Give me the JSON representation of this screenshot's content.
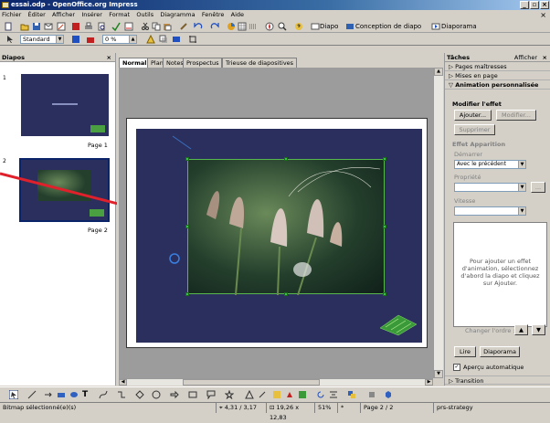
{
  "window": {
    "title": "essai.odp - OpenOffice.org Impress",
    "min": "_",
    "max": "▫",
    "close": "×",
    "doc_close": "×"
  },
  "menu": [
    "Fichier",
    "Éditer",
    "Afficher",
    "Insérer",
    "Format",
    "Outils",
    "Diagramma",
    "Fenêtre",
    "Aide"
  ],
  "toolbar": {
    "diapo_label": "Diapo",
    "conception_label": "Conception de diapo",
    "diaporama_label": "Diaporama",
    "style_value": "Standard",
    "line_width_value": "0 %"
  },
  "diapos_panel": {
    "title": "Diapos",
    "close": "×",
    "slides": [
      {
        "num": "1",
        "page_label": "Page 1"
      },
      {
        "num": "2",
        "page_label": "Page 2"
      }
    ]
  },
  "tabs": [
    "Normal",
    "Plan",
    "Notes",
    "Prospectus",
    "Trieuse de diapositives"
  ],
  "tasks_panel": {
    "title": "Tâches",
    "afficher": "Afficher",
    "close": "×",
    "sections": {
      "pages": "Pages maîtresses",
      "mises": "Mises en page",
      "anim": "Animation personnalisée",
      "transition": "Transition"
    },
    "modifier_effet": "Modifier l'effet",
    "ajouter": "Ajouter...",
    "modifier": "Modifier...",
    "supprimer": "Supprimer",
    "effet": "Effet Apparition",
    "demarrer_label": "Démarrer",
    "demarrer_value": "Avec le précédent",
    "propriete_label": "Propriété",
    "propriete_btn": "...",
    "vitesse_label": "Vitesse",
    "info_text": "Pour ajouter un effet d'animation, sélectionnez d'abord la diapo et cliquez sur Ajouter.",
    "changer_ordre": "Changer l'ordre :",
    "lire": "Lire",
    "diaporama": "Diaporama",
    "apercu": "Aperçu automatique"
  },
  "status": {
    "selection": "Bitmap sélectionné(e)(s)",
    "position": "4,31 / 3,17",
    "size": "19,26 x 12,83",
    "zoom": "51%",
    "modified": "*",
    "page": "Page 2 / 2",
    "style": "prs-strategy"
  },
  "colors": {
    "slide_bg": "#2b2f5e",
    "arrow": "#e0202a",
    "handle": "#38c24a"
  }
}
